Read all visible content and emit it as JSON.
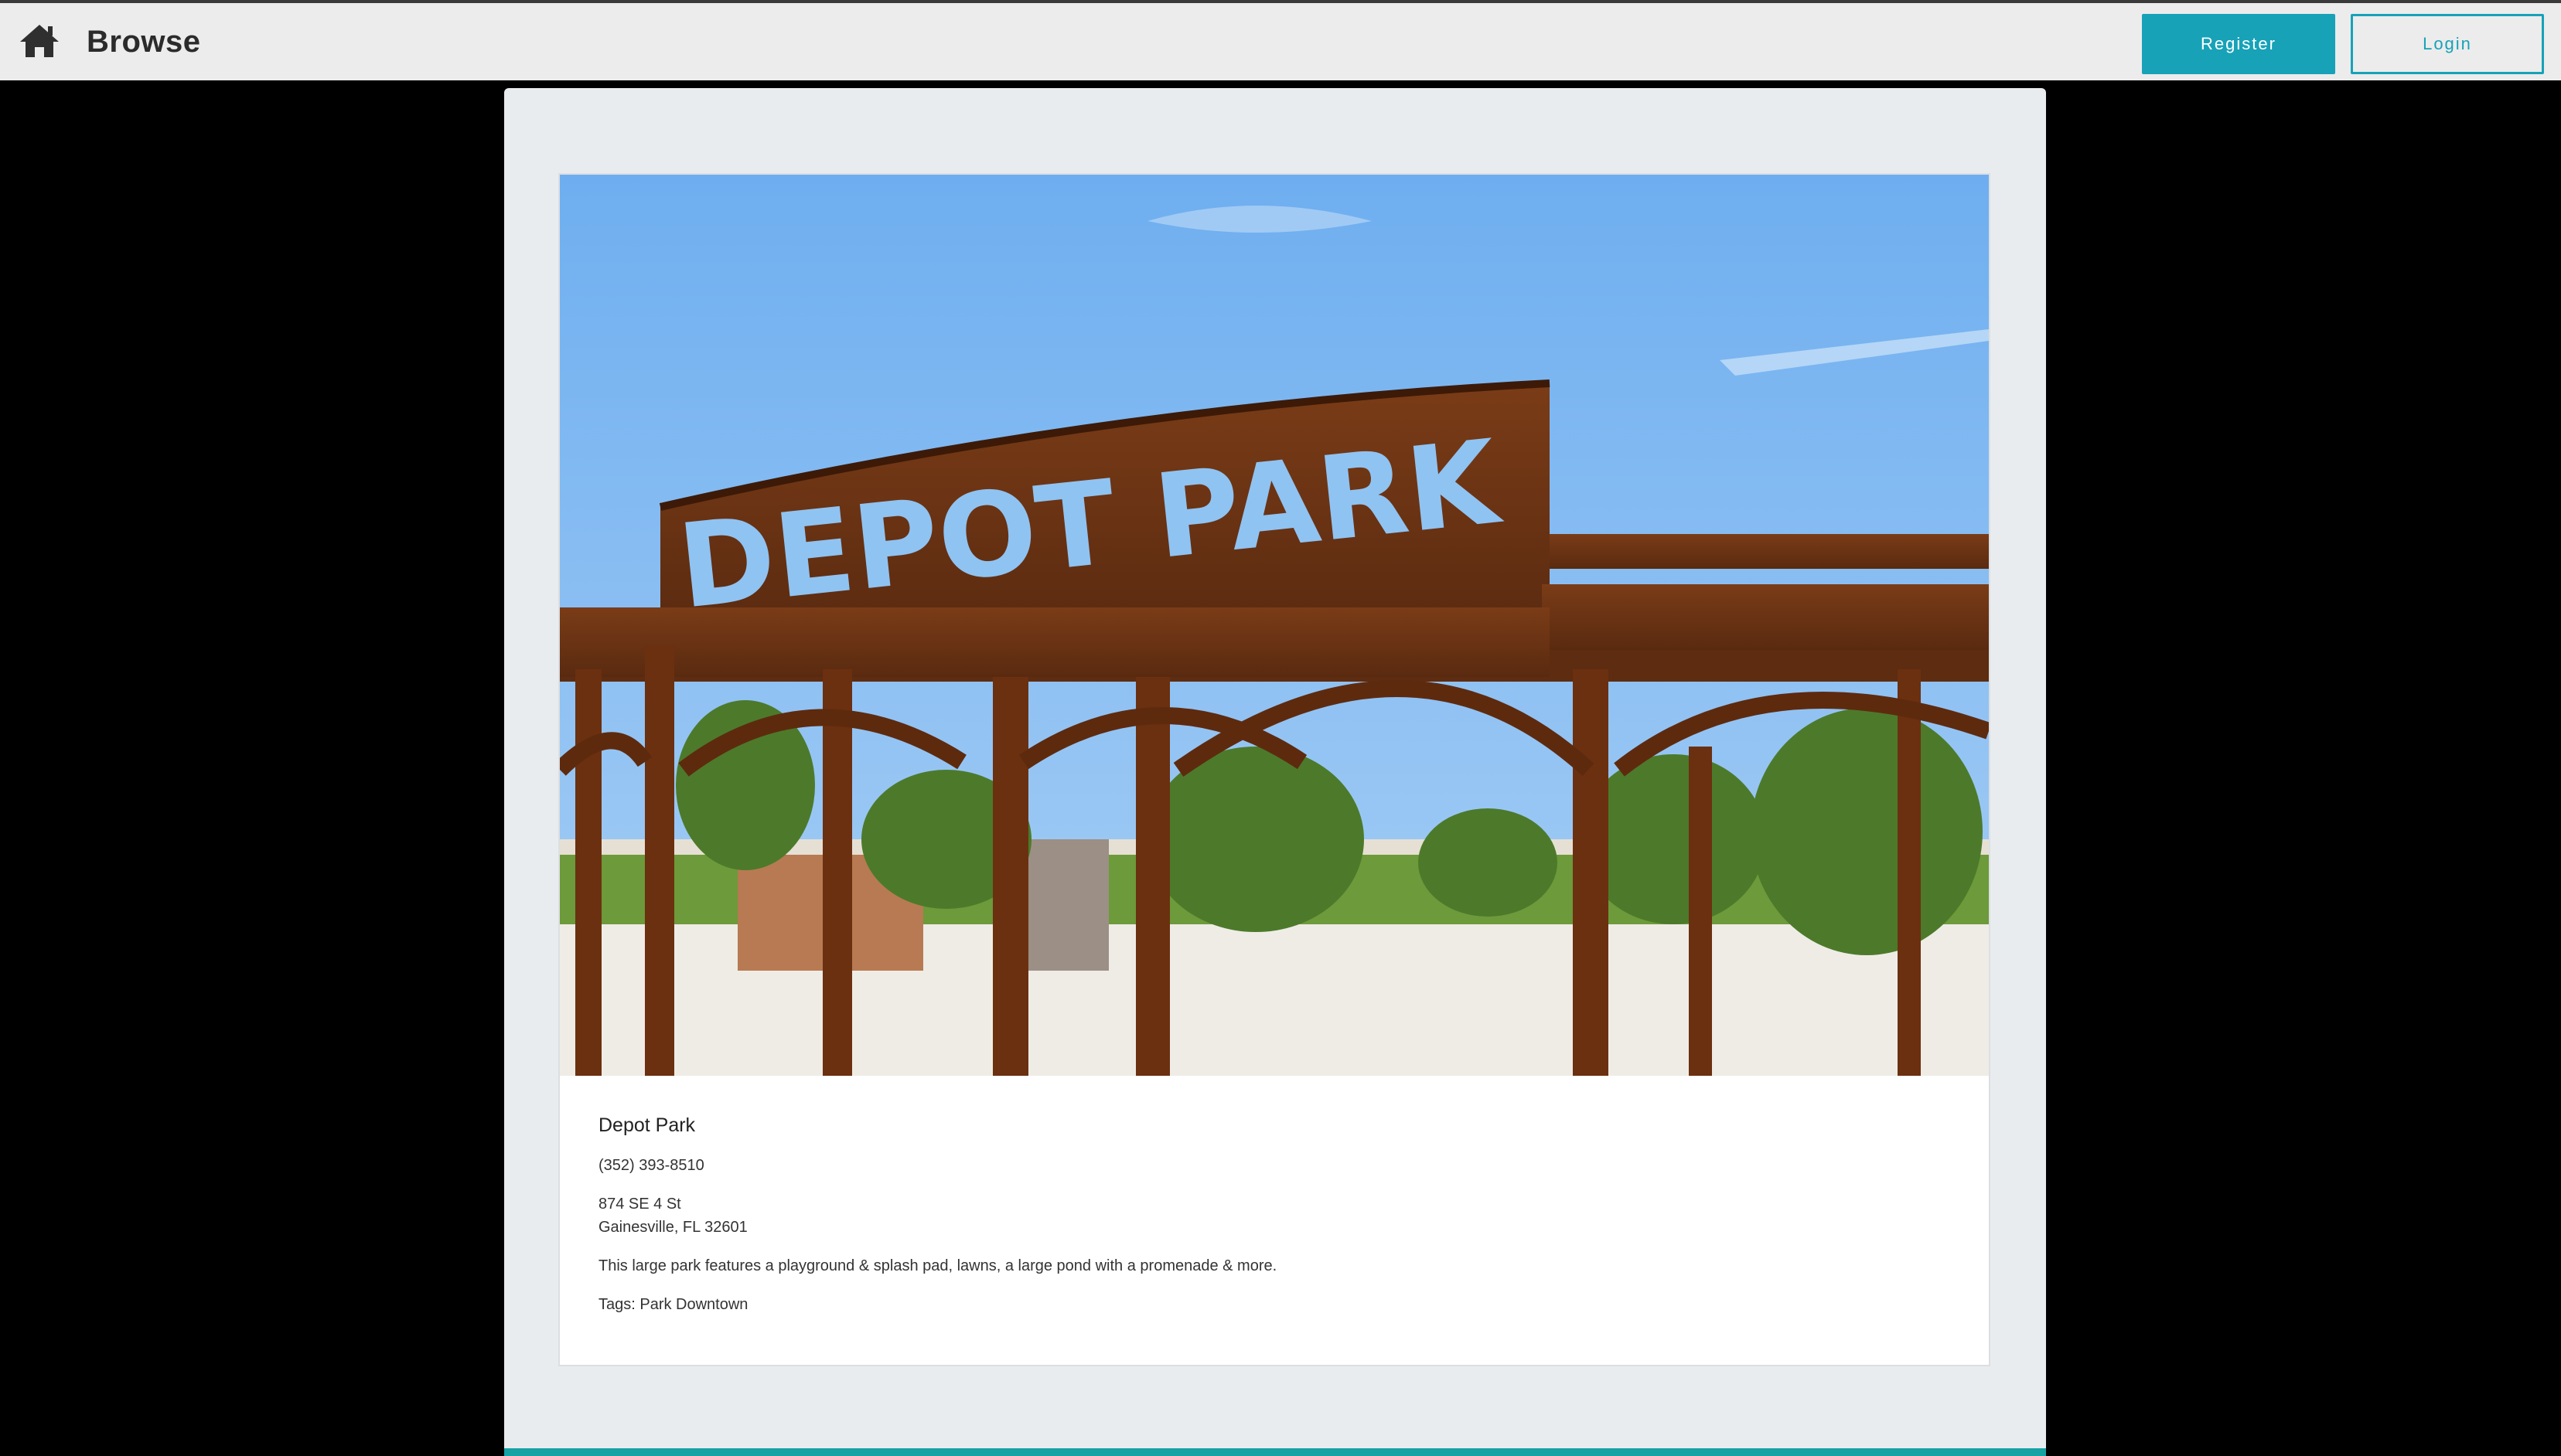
{
  "header": {
    "home_icon": "home-icon",
    "title": "Browse",
    "register_label": "Register",
    "login_label": "Login"
  },
  "place": {
    "photo_sign_text": "DEPOT PARK",
    "name": "Depot Park",
    "phone": "(352) 393-8510",
    "address_line1": "874 SE 4 St",
    "address_line2": "Gainesville, FL 32601",
    "description": "This large park features a playground & splash pad, lawns, a large pond with a promenade & more.",
    "tags": "Tags: Park Downtown"
  },
  "colors": {
    "accent": "#17a2b8",
    "topbar_bg": "#ececec",
    "panel_bg": "#e9ecef",
    "page_bg": "#000000"
  }
}
